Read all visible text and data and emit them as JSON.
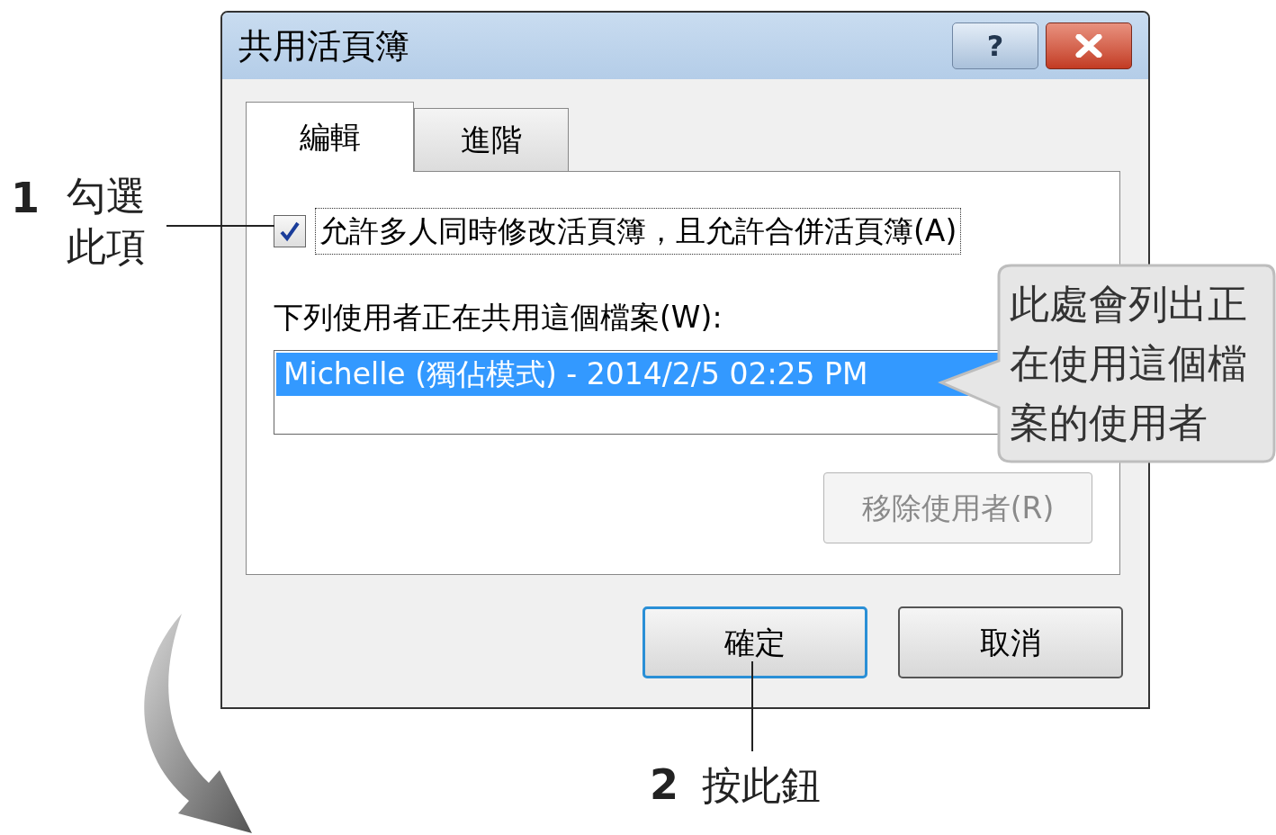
{
  "dialog": {
    "title": "共用活頁簿",
    "help_button": "?",
    "tabs": [
      {
        "label": "編輯",
        "selected": true
      },
      {
        "label": "進階",
        "selected": false
      }
    ],
    "allow_checkbox": {
      "label": "允許多人同時修改活頁簿，且允許合併活頁簿(A)",
      "checked": true
    },
    "users_label": "下列使用者正在共用這個檔案(W):",
    "users": [
      {
        "text": "Michelle (獨佔模式) - 2014/2/5 02:25 PM",
        "selected": true
      }
    ],
    "remove_button": {
      "label": "移除使用者(R)",
      "disabled": true
    },
    "ok_button": "確定",
    "cancel_button": "取消"
  },
  "annotations": {
    "step1": {
      "number": "1",
      "lines": [
        "勾選",
        "此項"
      ]
    },
    "callout": {
      "lines": [
        "此處會列出正",
        "在使用這個檔",
        "案的使用者"
      ]
    },
    "step2": {
      "number": "2",
      "text": "按此鈕"
    }
  }
}
